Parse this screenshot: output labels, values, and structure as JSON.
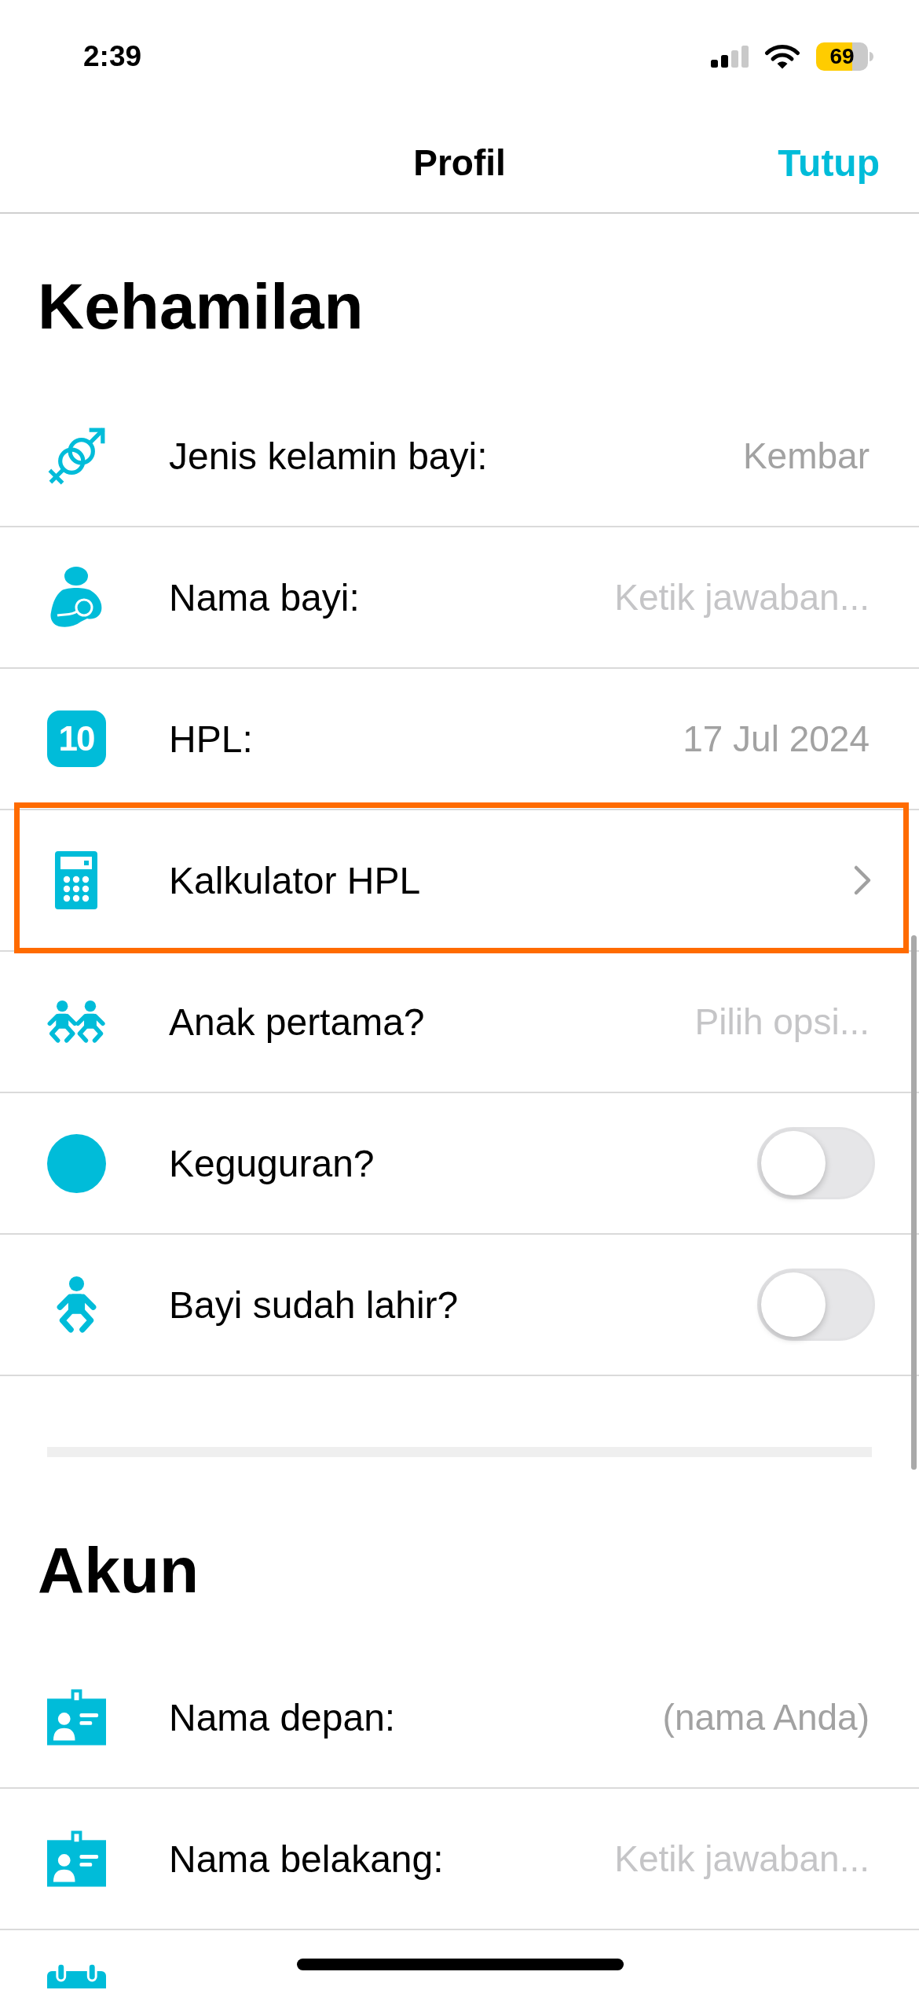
{
  "status_bar": {
    "time": "2:39",
    "battery": "69"
  },
  "nav": {
    "title": "Profil",
    "action": "Tutup"
  },
  "sections": [
    {
      "title": "Kehamilan",
      "rows": [
        {
          "kind": "picker",
          "label": "Jenis kelamin bayi:",
          "value": "Kembar",
          "highlighted": false
        },
        {
          "kind": "input",
          "label": "Nama bayi:",
          "placeholder": "Ketik jawaban...",
          "highlighted": false
        },
        {
          "kind": "picker",
          "label": "HPL:",
          "value": "17 Jul 2024",
          "icon_text": "10",
          "highlighted": false
        },
        {
          "kind": "link",
          "label": "Kalkulator HPL",
          "highlighted": true
        },
        {
          "kind": "picker",
          "label": "Anak pertama?",
          "placeholder": "Pilih opsi...",
          "highlighted": false
        },
        {
          "kind": "toggle",
          "label": "Keguguran?",
          "on": false,
          "highlighted": false
        },
        {
          "kind": "toggle",
          "label": "Bayi sudah lahir?",
          "on": false,
          "highlighted": false
        }
      ]
    },
    {
      "title": "Akun",
      "rows": [
        {
          "kind": "input",
          "label": "Nama depan:",
          "value": "(nama Anda)",
          "highlighted": false
        },
        {
          "kind": "input",
          "label": "Nama belakang:",
          "placeholder": "Ketik jawaban...",
          "highlighted": false
        },
        {
          "kind": "cut",
          "highlighted": false
        }
      ]
    }
  ]
}
